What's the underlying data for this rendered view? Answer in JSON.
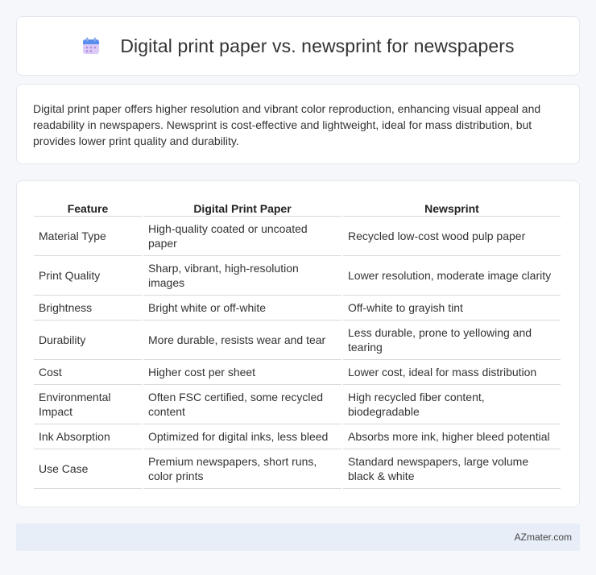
{
  "header": {
    "title": "Digital print paper vs. newsprint for newspapers",
    "icon": "calendar-icon",
    "icon_colors": {
      "top": "#5b8def",
      "body": "#d9c8f5",
      "dots": "#a98be0"
    }
  },
  "summary": {
    "text": "Digital print paper offers higher resolution and vibrant color reproduction, enhancing visual appeal and readability in newspapers. Newsprint is cost-effective and lightweight, ideal for mass distribution, but provides lower print quality and durability."
  },
  "table": {
    "headers": [
      "Feature",
      "Digital Print Paper",
      "Newsprint"
    ],
    "rows": [
      [
        "Material Type",
        "High-quality coated or uncoated paper",
        "Recycled low-cost wood pulp paper"
      ],
      [
        "Print Quality",
        "Sharp, vibrant, high-resolution images",
        "Lower resolution, moderate image clarity"
      ],
      [
        "Brightness",
        "Bright white or off-white",
        "Off-white to grayish tint"
      ],
      [
        "Durability",
        "More durable, resists wear and tear",
        "Less durable, prone to yellowing and tearing"
      ],
      [
        "Cost",
        "Higher cost per sheet",
        "Lower cost, ideal for mass distribution"
      ],
      [
        "Environmental Impact",
        "Often FSC certified, some recycled content",
        "High recycled fiber content, biodegradable"
      ],
      [
        "Ink Absorption",
        "Optimized for digital inks, less bleed",
        "Absorbs more ink, higher bleed potential"
      ],
      [
        "Use Case",
        "Premium newspapers, short runs, color prints",
        "Standard newspapers, large volume black & white"
      ]
    ]
  },
  "footer": {
    "text": "AZmater.com"
  }
}
